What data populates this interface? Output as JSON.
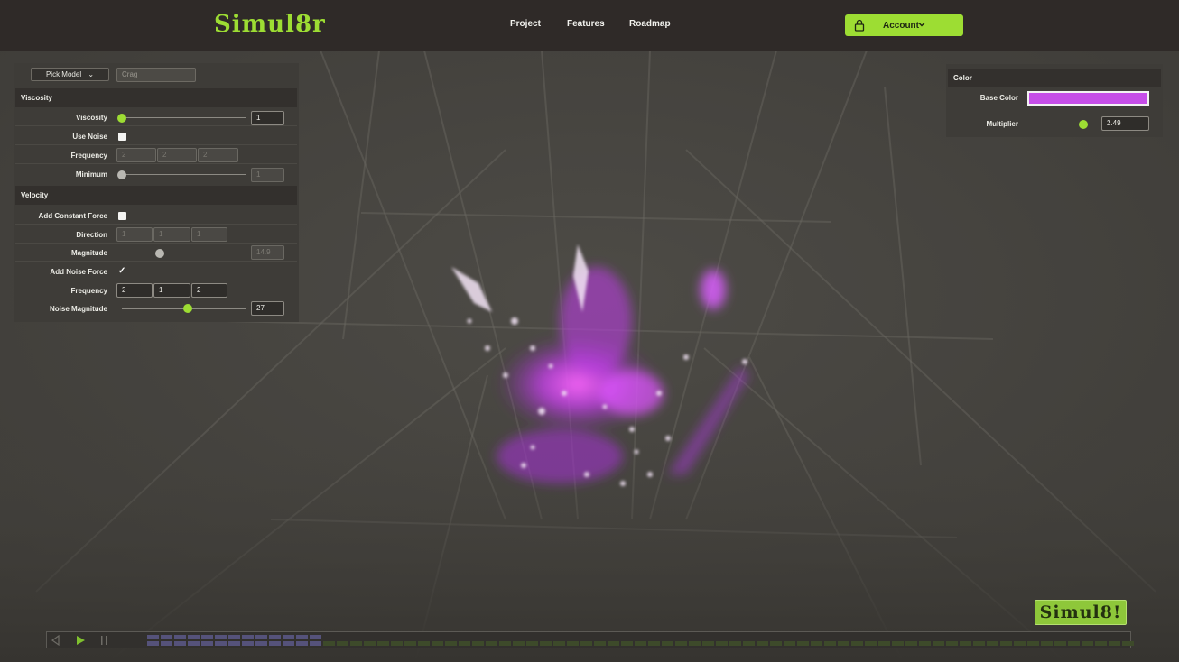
{
  "header": {
    "logo": "Simul8r",
    "nav": [
      "Project",
      "Features",
      "Roadmap"
    ],
    "account_label": "Account"
  },
  "left_panel": {
    "pick_model_label": "Pick Model",
    "model_placeholder": "Crag",
    "viscosity": {
      "title": "Viscosity",
      "viscosity_label": "Viscosity",
      "viscosity_value": "1",
      "viscosity_level": 0.0,
      "use_noise_label": "Use Noise",
      "use_noise": false,
      "frequency_label": "Frequency",
      "frequency": [
        "2",
        "2",
        "2"
      ],
      "minimum_label": "Minimum",
      "minimum_value": "1",
      "minimum_level": 0.0
    },
    "velocity": {
      "title": "Velocity",
      "constant_force_label": "Add Constant Force",
      "constant_force": false,
      "direction_label": "Direction",
      "direction": [
        "1",
        "1",
        "1"
      ],
      "magnitude_label": "Magnitude",
      "magnitude_value": "14.9",
      "magnitude_level": 0.3,
      "noise_force_label": "Add Noise Force",
      "noise_force": true,
      "noise_frequency_label": "Frequency",
      "noise_frequency": [
        "2",
        "1",
        "2"
      ],
      "noise_magnitude_label": "Noise Magnitude",
      "noise_magnitude_value": "27",
      "noise_magnitude_level": 0.54
    }
  },
  "right_panel": {
    "title": "Color",
    "base_color_label": "Base Color",
    "base_color": "#c64de8",
    "multiplier_label": "Multiplier",
    "multiplier_value": "2.49",
    "multiplier_level": 0.8
  },
  "bottom": {
    "badge": "Simul8!",
    "timeline_played_columns": 13,
    "timeline_total_columns": 73
  },
  "colors": {
    "accent": "#9ddd33",
    "fluid": "#c64de8",
    "played_frame": "#55527a",
    "unplayed_frame": "#3d4a2a"
  }
}
